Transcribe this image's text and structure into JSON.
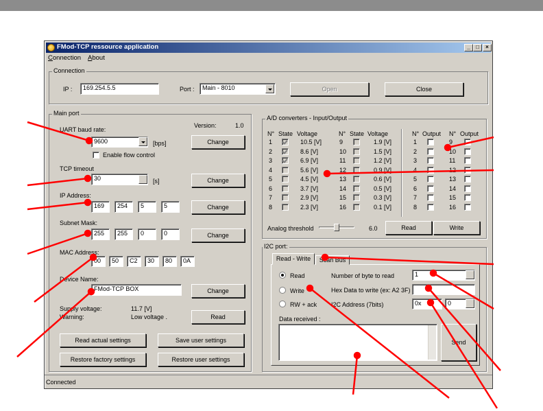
{
  "window": {
    "title": "FMod-TCP ressource application"
  },
  "menu": {
    "connection": "Connection",
    "about": "About"
  },
  "connection": {
    "group_label": "Connection",
    "ip_label": "IP :",
    "ip_value": "169.254.5.5",
    "port_label": "Port :",
    "port_value": "Main - 8010",
    "open_label": "Open",
    "close_label": "Close"
  },
  "main_port": {
    "group_label": "Main port",
    "version_label": "Version:",
    "version_value": "1.0",
    "baud_label": "UART baud rate:",
    "baud_value": "9600",
    "baud_unit": "[bps]",
    "flow_label": "Enable flow control",
    "change_label": "Change",
    "tcp_label": "TCP timeout",
    "tcp_value": "30",
    "tcp_unit": "[s]",
    "ip_label": "IP Address:",
    "ip_octets": [
      "169",
      "254",
      "5",
      "5"
    ],
    "mask_label": "Subnet Mask:",
    "mask_octets": [
      "255",
      "255",
      "0",
      "0"
    ],
    "mac_label": "MAC Address:",
    "mac_parts": [
      "00",
      "50",
      "C2",
      "30",
      "80",
      "0A"
    ],
    "device_label": "Device Name:",
    "device_value": "FMod-TCP BOX",
    "supply_label": "Supply voltage:",
    "supply_value": "11.7 [V]",
    "warning_label": "Warning:",
    "warning_value": "Low voltage .",
    "read_label": "Read",
    "read_actual": "Read actual settings",
    "save_user": "Save user settings",
    "restore_factory": "Restore factory settings",
    "restore_user": "Restore user settings"
  },
  "ad": {
    "group_label": "A/D converters - Input/Output",
    "headers": {
      "n": "N°",
      "state": "State",
      "voltage": "Voltage",
      "output": "Output"
    },
    "left": [
      {
        "n": "1",
        "state": true,
        "v": "10.5 [V]"
      },
      {
        "n": "2",
        "state": true,
        "v": "8.6 [V]"
      },
      {
        "n": "3",
        "state": true,
        "v": "6.9 [V]"
      },
      {
        "n": "4",
        "state": false,
        "v": "5.6 [V]"
      },
      {
        "n": "5",
        "state": false,
        "v": "4.5 [V]"
      },
      {
        "n": "6",
        "state": false,
        "v": "3.7 [V]"
      },
      {
        "n": "7",
        "state": false,
        "v": "2.9 [V]"
      },
      {
        "n": "8",
        "state": false,
        "v": "2.3 [V]"
      }
    ],
    "right": [
      {
        "n": "9",
        "v": "1.9 [V]"
      },
      {
        "n": "10",
        "v": "1.5 [V]"
      },
      {
        "n": "11",
        "v": "1.2 [V]"
      },
      {
        "n": "12",
        "v": "0.9 [V]"
      },
      {
        "n": "13",
        "v": "0.6 [V]"
      },
      {
        "n": "14",
        "v": "0.5 [V]"
      },
      {
        "n": "15",
        "v": "0.3 [V]"
      },
      {
        "n": "16",
        "v": "0.1 [V]"
      }
    ],
    "out_left": [
      "1",
      "2",
      "3",
      "4",
      "5",
      "6",
      "7",
      "8"
    ],
    "out_right": [
      "9",
      "10",
      "11",
      "12",
      "13",
      "14",
      "15",
      "16"
    ],
    "threshold_label": "Analog threshold",
    "threshold_value": "6.0",
    "read_label": "Read",
    "write_label": "Write"
  },
  "i2c": {
    "group_label": "I2C port:",
    "tab_rw": "Read - Write",
    "tab_scan": "Scan Bus",
    "radio_read": "Read",
    "radio_write": "Write",
    "radio_rwack": "RW + ack",
    "nbytes_label": "Number of byte to read",
    "nbytes_value": "1",
    "hex_label": "Hex Data to write (ex: A2 3F)",
    "hex_value": "",
    "addr_label": "I2C Address (7bits)",
    "addr_value": "0x",
    "addr_index": "0",
    "data_label": "Data received :",
    "send_label": "Send"
  },
  "status": {
    "text": "Connected"
  },
  "colors": {
    "annotation": "#ff0000",
    "titlebar": "#0a246a",
    "face": "#d4d0c8"
  }
}
